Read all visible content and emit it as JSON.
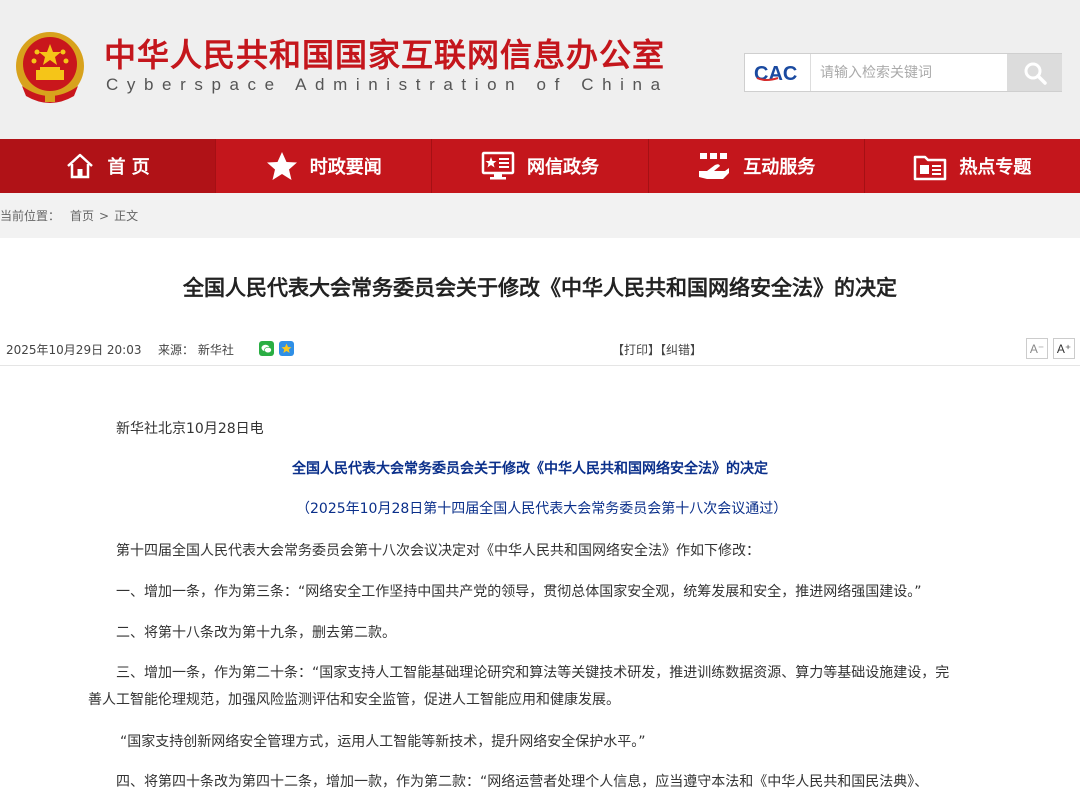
{
  "header": {
    "title": "中华人民共和国国家互联网信息办公室",
    "subtitle": "Cyberspace Administration of China",
    "colors": {
      "brand_red": "#c4161c",
      "nav_bg": "#c4161c"
    }
  },
  "search": {
    "logo_text": "CAC",
    "placeholder": "请输入检索关键词",
    "button_icon": "search-icon"
  },
  "nav": {
    "items": [
      {
        "label": "首 页",
        "icon": "home-icon"
      },
      {
        "label": "时政要闻",
        "icon": "star-icon"
      },
      {
        "label": "网信政务",
        "icon": "monitor-icon"
      },
      {
        "label": "互动服务",
        "icon": "hand-icon"
      },
      {
        "label": "热点专题",
        "icon": "folder-icon"
      }
    ]
  },
  "breadcrumb": {
    "prefix": "当前位置：",
    "home": "首页",
    "separator": ">",
    "current": "正文"
  },
  "article": {
    "title": "全国人民代表大会常务委员会关于修改《中华人民共和国网络安全法》的决定",
    "date": "2025年10月29日 20:03",
    "source": "来源： 新华社",
    "print": "【打印】",
    "correct": "【纠错】",
    "font_small": "A⁻",
    "font_large": "A⁺",
    "paragraphs": [
      "新华社北京10月28日电",
      "全国人民代表大会常务委员会关于修改《中华人民共和国网络安全法》的决定",
      "（2025年10月28日第十四届全国人民代表大会常务委员会第十八次会议通过）",
      "第十四届全国人民代表大会常务委员会第十八次会议决定对《中华人民共和国网络安全法》作如下修改：",
      "一、增加一条，作为第三条：“网络安全工作坚持中国共产党的领导，贯彻总体国家安全观，统筹发展和安全，推进网络强国建设。”",
      "二、将第十八条改为第十九条，删去第二款。",
      "三、增加一条，作为第二十条：“国家支持人工智能基础理论研究和算法等关键技术研发，推进训练数据资源、算力等基础设施建设，完",
      "善人工智能伦理规范，加强风险监测评估和安全监管，促进人工智能应用和健康发展。",
      "“国家支持创新网络安全管理方式，运用人工智能等新技术，提升网络安全保护水平。”",
      "四、将第四十条改为第四十二条，增加一款，作为第二款：“网络运营者处理个人信息，应当遵守本法和《中华人民共和国民法典》、"
    ]
  }
}
